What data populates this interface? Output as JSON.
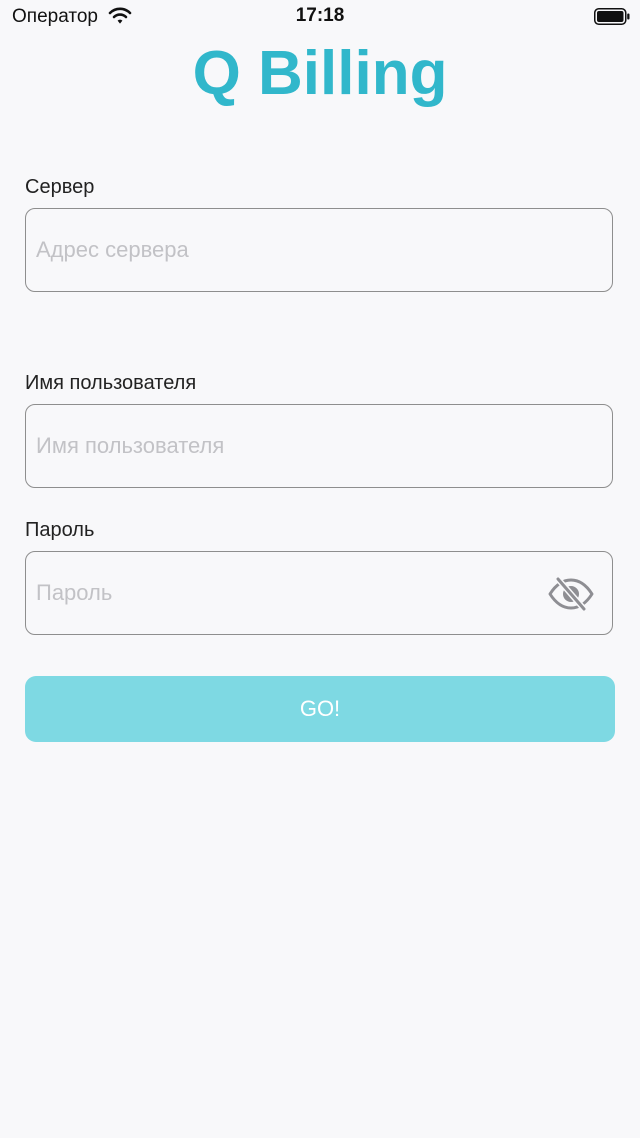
{
  "status_bar": {
    "carrier": "Оператор",
    "time": "17:18",
    "wifi_icon": "wifi-icon",
    "battery_icon": "battery-icon"
  },
  "app": {
    "title": "Q Billing",
    "accent_color": "#31b7cb"
  },
  "form": {
    "server": {
      "label": "Сервер",
      "placeholder": "Адрес сервера",
      "value": ""
    },
    "username": {
      "label": "Имя пользователя",
      "placeholder": "Имя пользователя",
      "value": ""
    },
    "password": {
      "label": "Пароль",
      "placeholder": "Пароль",
      "value": "",
      "toggle_icon": "eye-slash-icon"
    },
    "submit": {
      "label": "GO!",
      "color": "#7ed9e3"
    }
  }
}
